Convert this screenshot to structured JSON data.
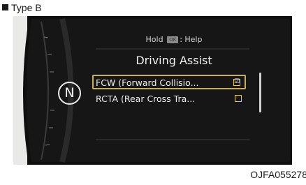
{
  "type_label": "Type B",
  "icons": {
    "bullet": "square-bullet-icon",
    "gear": "n-gear-indicator-icon",
    "checked": "checked-box-icon",
    "unchecked": "unchecked-box-icon"
  },
  "cluster": {
    "gear_letter": "N",
    "header": {
      "prefix": "Hold",
      "key": "OK",
      "suffix": ": Help"
    },
    "menu_title": "Driving Assist",
    "items": [
      {
        "label": "FCW (Forward Collisio...",
        "checked": true,
        "selected": true,
        "mark": "☑"
      },
      {
        "label": "RCTA (Rear Cross Tra...",
        "checked": false,
        "selected": false,
        "mark": ""
      }
    ]
  },
  "figure_code": "OJFA055278",
  "colors": {
    "screen": "#141414",
    "selection_border": "#c9ae5a",
    "checkbox": "#e8c93a",
    "text": "#eeeeee"
  }
}
